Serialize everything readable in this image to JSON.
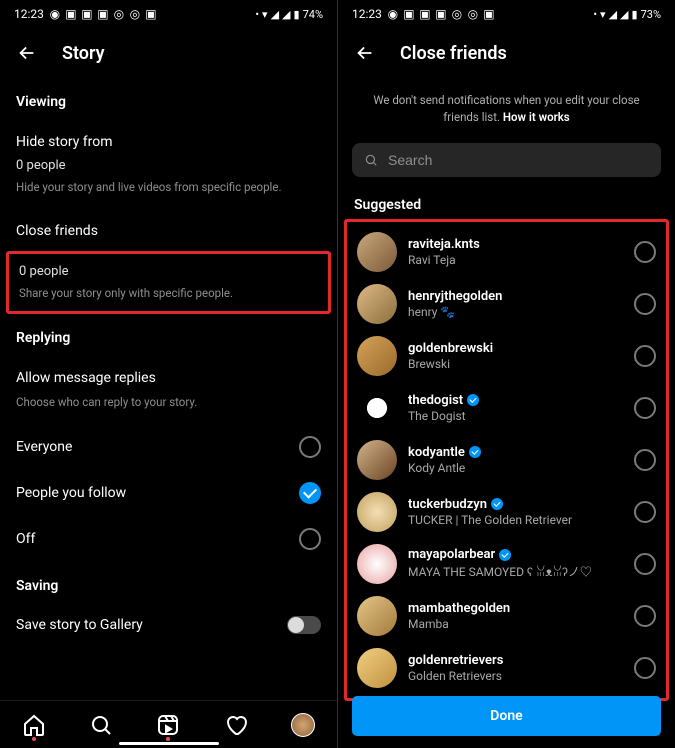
{
  "left": {
    "status": {
      "time": "12:23",
      "battery": "74%"
    },
    "title": "Story",
    "viewing": {
      "label": "Viewing",
      "hide": {
        "title": "Hide story from",
        "value": "0 people",
        "sub": "Hide your story and live videos from specific people."
      },
      "close": {
        "title": "Close friends",
        "value": "0 people",
        "sub": "Share your story only with specific people."
      }
    },
    "replying": {
      "label": "Replying",
      "allow": {
        "title": "Allow message replies",
        "sub": "Choose who can reply to your story."
      },
      "opts": [
        "Everyone",
        "People you follow",
        "Off"
      ],
      "selected": 1
    },
    "saving": {
      "label": "Saving",
      "row": "Save story to Gallery"
    }
  },
  "right": {
    "status": {
      "time": "12:23",
      "battery": "73%"
    },
    "title": "Close friends",
    "subtitle_a": "We don't send notifications when you edit your close friends list. ",
    "subtitle_b": "How it works",
    "search_placeholder": "Search",
    "suggested": "Suggested",
    "friends": [
      {
        "user": "raviteja.knts",
        "name": "Ravi Teja",
        "verified": false,
        "avatar": "linear-gradient(135deg,#c9a87a,#7a5a3a)"
      },
      {
        "user": "henryjthegolden",
        "name": "henry 🐾",
        "verified": false,
        "avatar": "linear-gradient(135deg,#deb887,#8b6f3a)"
      },
      {
        "user": "goldenbrewski",
        "name": "Brewski",
        "verified": false,
        "avatar": "linear-gradient(135deg,#d4a259,#9a6a2a)"
      },
      {
        "user": "thedogist",
        "name": "The Dogist",
        "verified": true,
        "avatar": "radial-gradient(circle,#fff 35%,#000 36%)"
      },
      {
        "user": "kodyantle",
        "name": "Kody Antle",
        "verified": true,
        "avatar": "linear-gradient(135deg,#d2b48c,#6b4423)"
      },
      {
        "user": "tuckerbudzyn",
        "name": "TUCKER | The Golden Retriever",
        "verified": true,
        "avatar": "radial-gradient(circle,#f5deb3,#bfa060)"
      },
      {
        "user": "mayapolarbear",
        "name": "MAYA THE SAMOYED ʕ ꈍᴥꈍʔノ♡",
        "verified": true,
        "avatar": "radial-gradient(circle,#fff,#e8a0a0)"
      },
      {
        "user": "mambathegolden",
        "name": "Mamba",
        "verified": false,
        "avatar": "linear-gradient(135deg,#e6c68a,#a07a3a)"
      },
      {
        "user": "goldenretrievers",
        "name": "Golden Retrievers",
        "verified": false,
        "avatar": "linear-gradient(135deg,#f0d080,#c09040)"
      }
    ],
    "done": "Done"
  }
}
